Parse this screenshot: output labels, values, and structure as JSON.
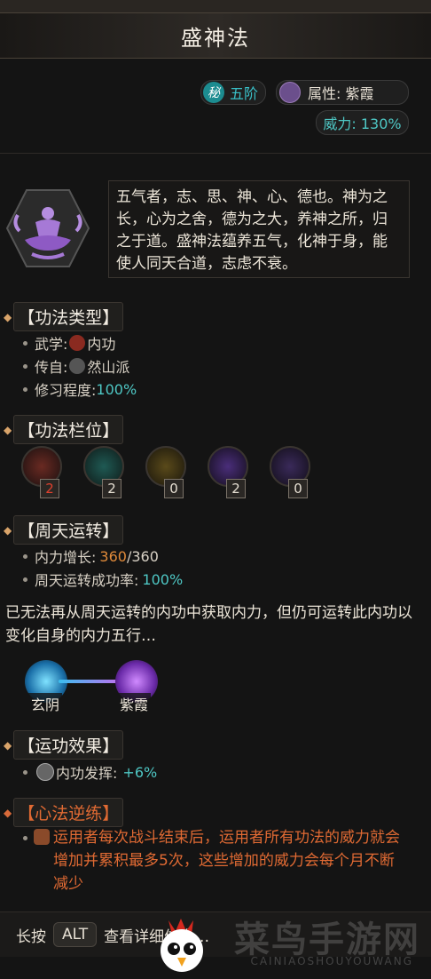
{
  "title": "盛神法",
  "badges": {
    "secret_mark": "秘",
    "level": "五阶",
    "attribute_label": "属性: 紫霞",
    "power": "威力: 130%"
  },
  "description": "五气者，志、思、神、心、德也。神为之长，心为之舍，德为之大，养神之所，归之于道。盛神法蕴养五气，化神于身，能使人同天合道，志虑不衰。",
  "sections": {
    "type": {
      "header": "【功法类型】",
      "martial_label": "武学:",
      "martial_value": "内功",
      "origin_label": "传自:",
      "origin_value": "然山派",
      "mastery_label": "修习程度:",
      "mastery_value": "100%"
    },
    "slots": {
      "header": "【功法栏位】",
      "items": [
        {
          "count": "2",
          "color": "#c0392b"
        },
        {
          "count": "2",
          "color": "#2aa39a"
        },
        {
          "count": "0",
          "color": "#c9a227"
        },
        {
          "count": "2",
          "color": "#8e5ad0"
        },
        {
          "count": "0",
          "color": "#7a4ab0"
        }
      ]
    },
    "cycle": {
      "header": "【周天运转】",
      "growth_label": "内力增长:",
      "growth_current": "360",
      "growth_sep_max": "/360",
      "rate_label": "周天运转成功率:",
      "rate_value": "100%"
    },
    "note": "已无法再从周天运转的内功中获取内力，但仍可运转此内功以变化自身的内力五行…",
    "transform": {
      "from": "玄阴",
      "to": "紫霞"
    },
    "effect": {
      "header": "【运功效果】",
      "label": "内功发挥:",
      "value": "+6%"
    },
    "heart": {
      "header": "【心法逆练】",
      "text": "运用者每次战斗结束后，运用者所有功法的威力就会增加并累积最多5次，这些增加的威力会每个月不断减少"
    }
  },
  "footer": {
    "prefix": "长按",
    "key": "ALT",
    "suffix": "查看详细信息…"
  },
  "watermark": {
    "main": "菜鸟手游网",
    "sub": "CAINIAOSHOUYOUWANG"
  }
}
